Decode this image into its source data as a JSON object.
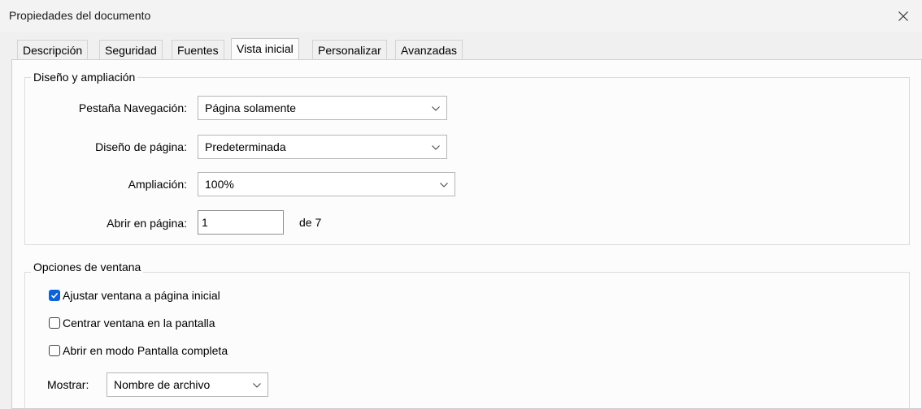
{
  "window": {
    "title": "Propiedades del documento"
  },
  "tabs": [
    {
      "label": "Descripción"
    },
    {
      "label": "Seguridad"
    },
    {
      "label": "Fuentes"
    },
    {
      "label": "Vista inicial",
      "active": true
    },
    {
      "label": "Personalizar"
    },
    {
      "label": "Avanzadas"
    }
  ],
  "layout_group": {
    "title": "Diseño y ampliación",
    "navigation_tab": {
      "label": "Pestaña Navegación:",
      "value": "Página solamente"
    },
    "page_layout": {
      "label": "Diseño de página:",
      "value": "Predeterminada"
    },
    "magnification": {
      "label": "Ampliación:",
      "value": "100%"
    },
    "open_to_page": {
      "label": "Abrir en página:",
      "value": "1",
      "suffix": "de 7"
    }
  },
  "window_group": {
    "title": "Opciones de ventana",
    "options": [
      {
        "label": "Ajustar ventana a página inicial",
        "checked": true
      },
      {
        "label": "Centrar ventana en la pantalla",
        "checked": false
      },
      {
        "label": "Abrir en modo Pantalla completa",
        "checked": false
      }
    ],
    "show": {
      "label": "Mostrar:",
      "value": "Nombre de archivo"
    }
  },
  "colors": {
    "checkbox_accent": "#0b63d8"
  },
  "icons": {
    "close": "close-icon",
    "dropdown": "chevron-down-icon",
    "check": "checkmark-icon"
  }
}
